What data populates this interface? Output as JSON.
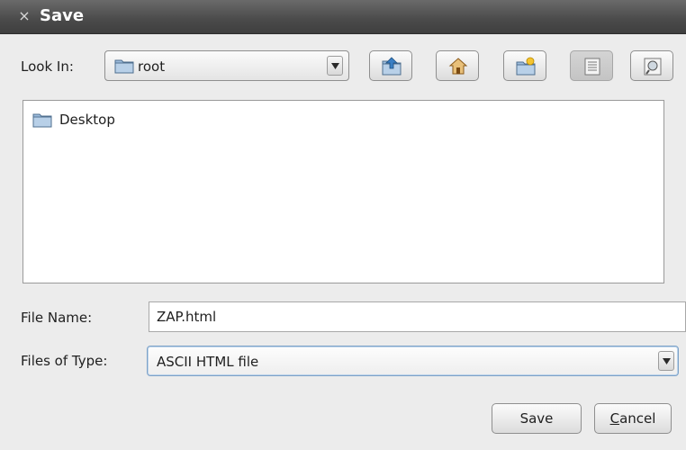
{
  "window": {
    "title": "Save",
    "close_glyph": "×"
  },
  "look_in": {
    "label": "Look In:",
    "value": "root",
    "icon": "folder-icon"
  },
  "toolbar": {
    "buttons": [
      {
        "name": "up-one-level-button",
        "icon": "folder-up-icon"
      },
      {
        "name": "home-button",
        "icon": "home-icon"
      },
      {
        "name": "new-folder-button",
        "icon": "new-folder-icon"
      },
      {
        "name": "list-view-button",
        "icon": "list-view-icon",
        "pressed": true
      },
      {
        "name": "details-view-button",
        "icon": "details-view-icon"
      }
    ]
  },
  "file_list": {
    "items": [
      {
        "label": "Desktop",
        "icon": "folder-icon"
      }
    ]
  },
  "file_name": {
    "label": "File Name:",
    "value": "ZAP.html"
  },
  "file_type": {
    "label": "Files of Type:",
    "value": "ASCII HTML file"
  },
  "buttons": {
    "save_label": "Save",
    "cancel_label": "Cancel"
  },
  "colors": {
    "titlebar": "#4a4a4a",
    "background": "#ececec",
    "focus_border": "#7da2c8",
    "folder_icon": "#7fa8cf"
  }
}
